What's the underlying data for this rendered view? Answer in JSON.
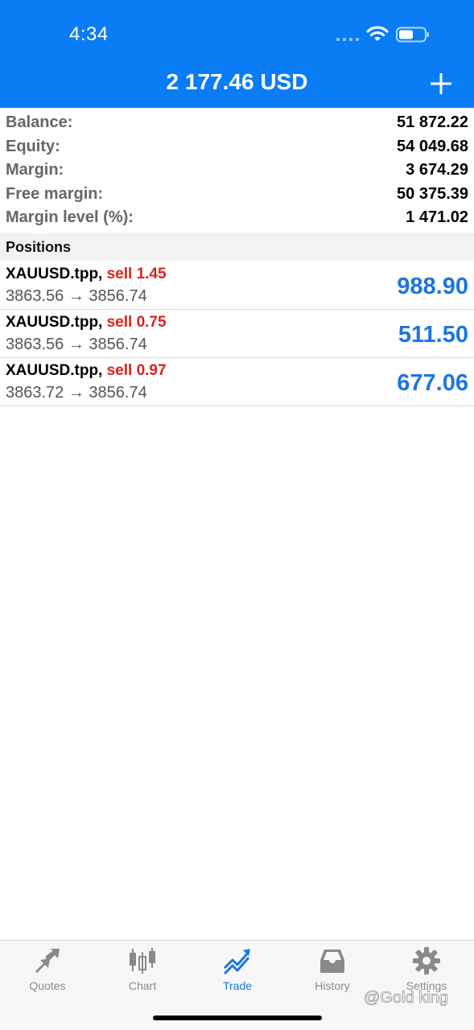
{
  "status_bar": {
    "time": "4:34"
  },
  "header": {
    "title": "2 177.46 USD",
    "add_icon": "plus-icon"
  },
  "summary": [
    {
      "label": "Balance:",
      "value": "51 872.22"
    },
    {
      "label": "Equity:",
      "value": "54 049.68"
    },
    {
      "label": "Margin:",
      "value": "3 674.29"
    },
    {
      "label": "Free margin:",
      "value": "50 375.39"
    },
    {
      "label": "Margin level (%):",
      "value": "1 471.02"
    }
  ],
  "positions_section": {
    "title": "Positions"
  },
  "positions": [
    {
      "symbol": "XAUUSD.tpp,",
      "side": "sell 1.45",
      "prices": "3863.56 → 3856.74",
      "profit": "988.90"
    },
    {
      "symbol": "XAUUSD.tpp,",
      "side": "sell 0.75",
      "prices": "3863.56 → 3856.74",
      "profit": "511.50"
    },
    {
      "symbol": "XAUUSD.tpp,",
      "side": "sell 0.97",
      "prices": "3863.72 → 3856.74",
      "profit": "677.06"
    }
  ],
  "tabs": [
    {
      "label": "Quotes",
      "icon": "quotes-arrows-icon"
    },
    {
      "label": "Chart",
      "icon": "candlestick-icon"
    },
    {
      "label": "Trade",
      "icon": "trade-trend-icon",
      "active": true
    },
    {
      "label": "History",
      "icon": "inbox-tray-icon"
    },
    {
      "label": "Settings",
      "icon": "gear-icon"
    }
  ],
  "watermark": "@Gold king",
  "colors": {
    "accent": "#0a7cf6",
    "sell": "#d9231d",
    "profit": "#1c75e0"
  }
}
